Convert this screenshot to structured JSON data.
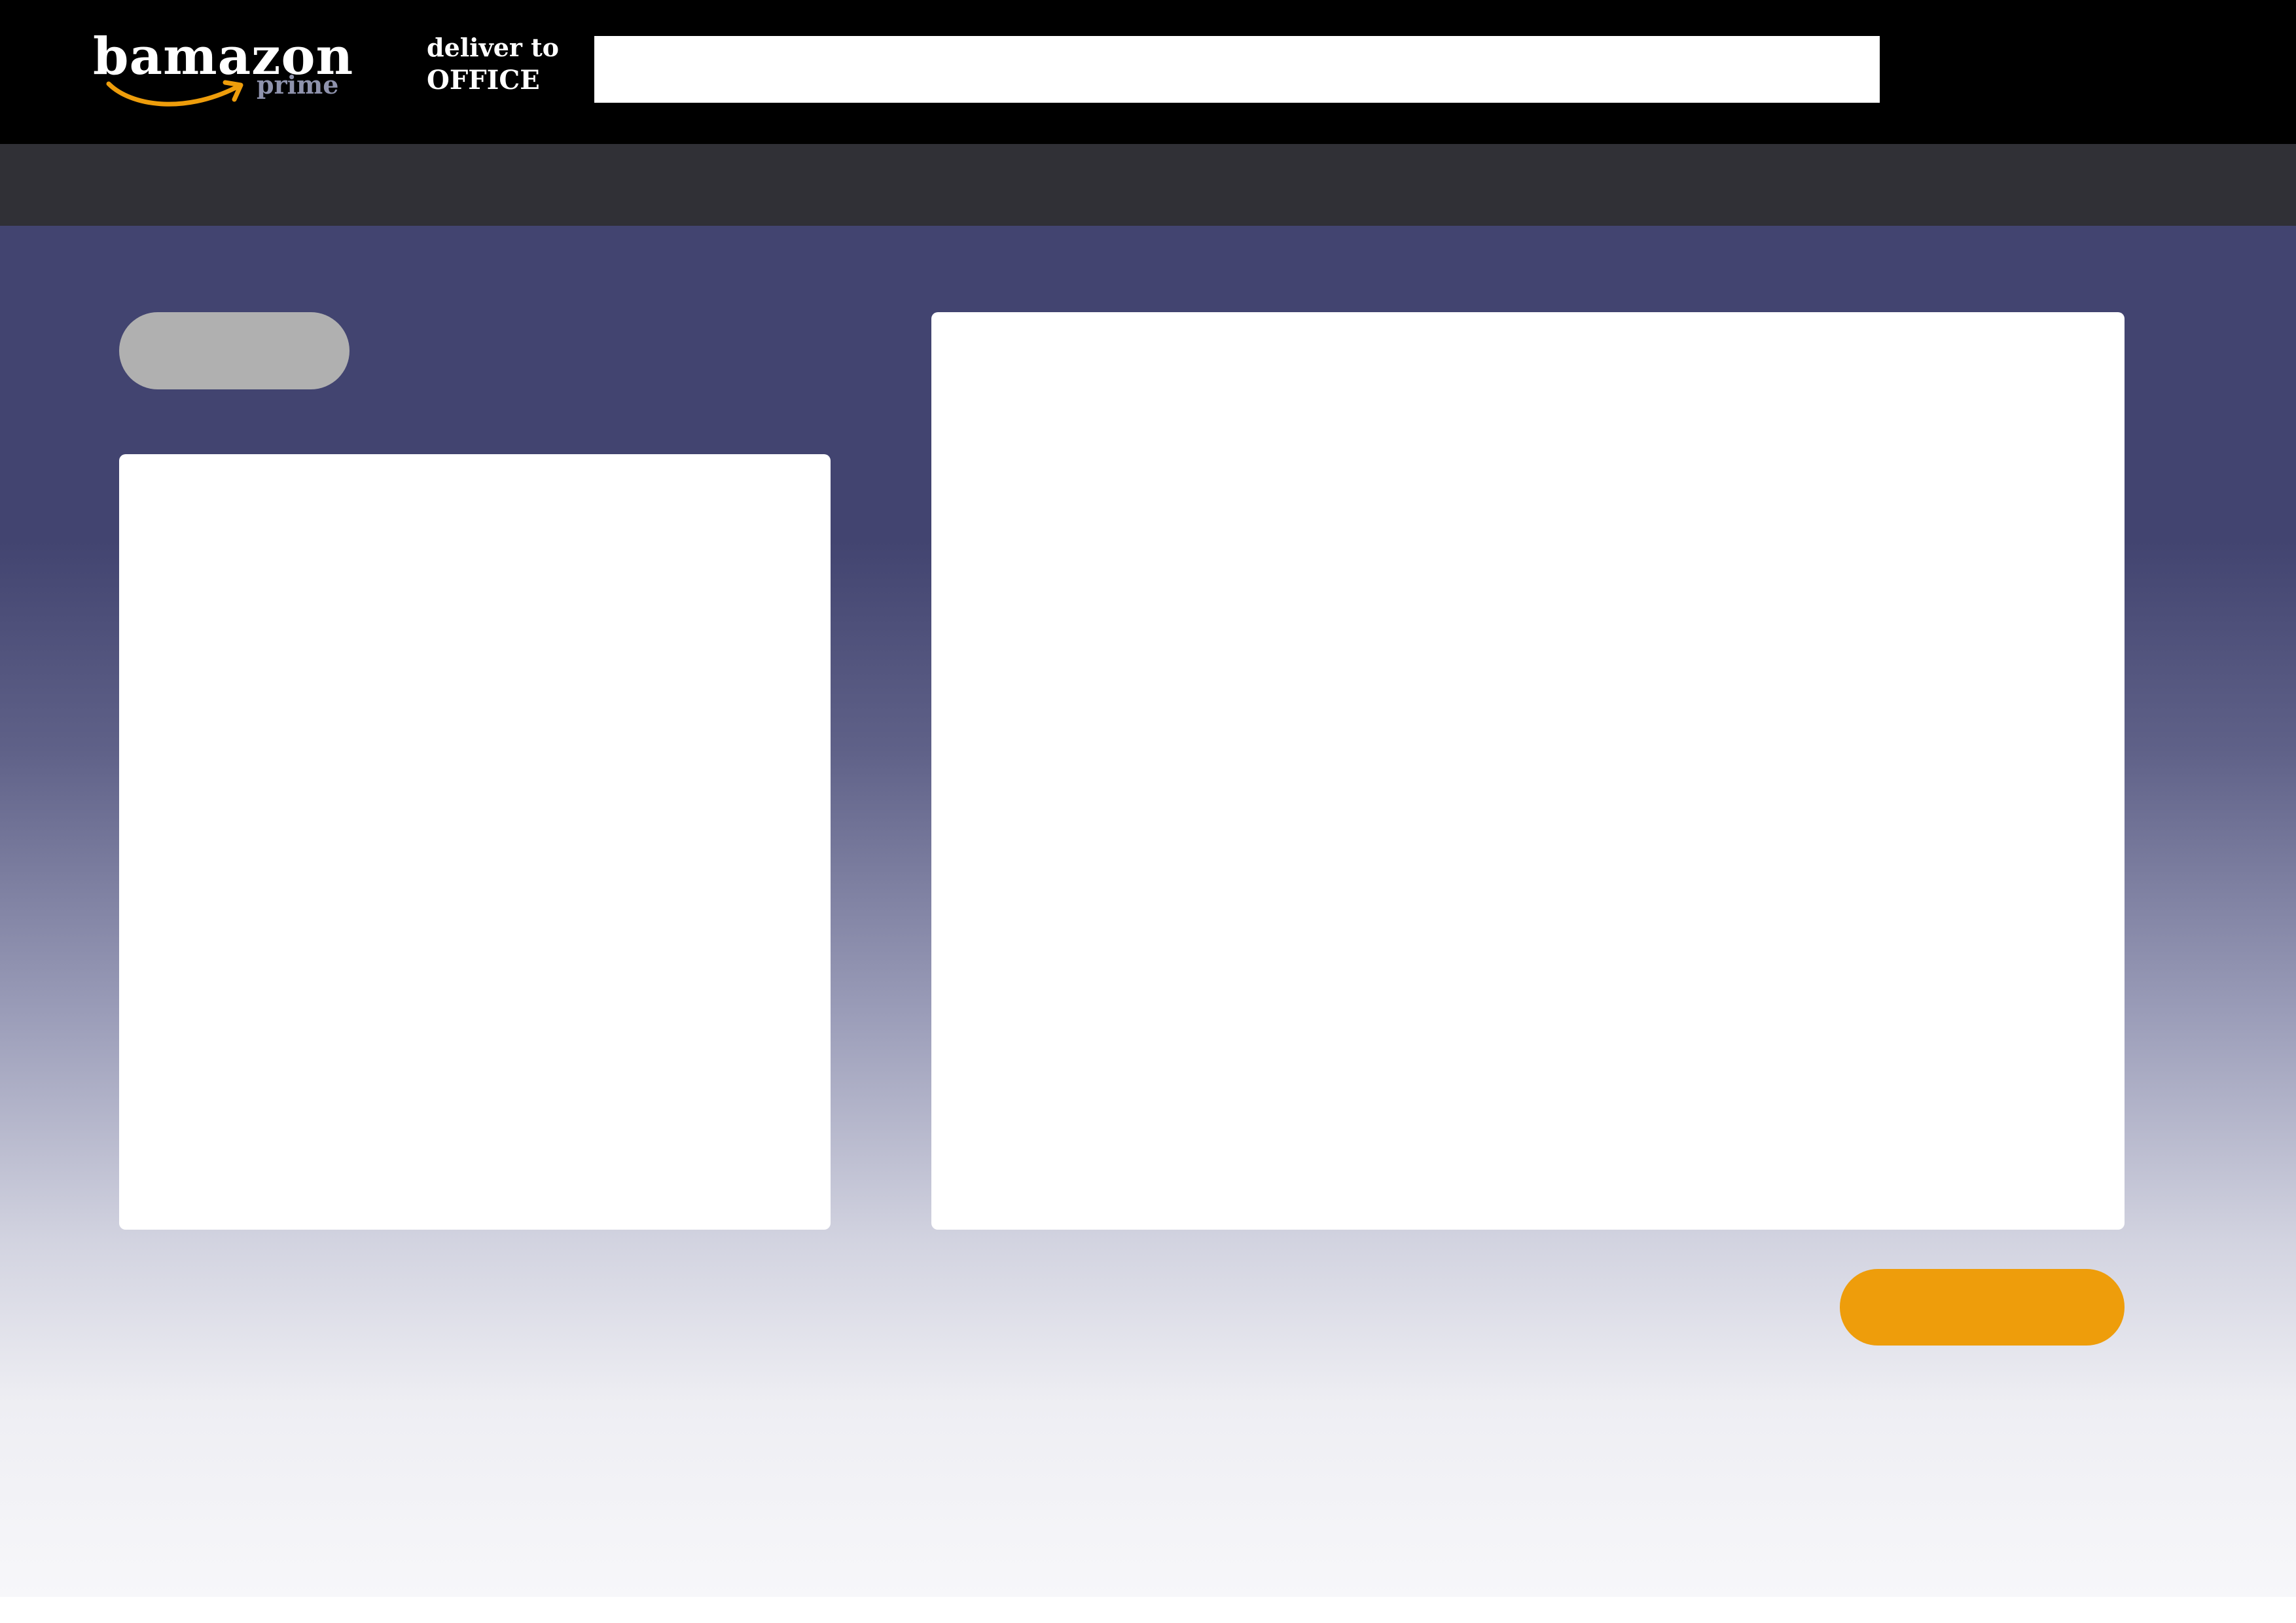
{
  "header": {
    "logo": {
      "wordmark": "bamazon",
      "tier": "prime",
      "accent_color": "#ee9d0b",
      "tier_color": "#8f93ad"
    },
    "deliver": {
      "label": "deliver to",
      "location": "OFFICE"
    },
    "search": {
      "value": ""
    },
    "background_color": "#000000"
  },
  "subnav": {
    "background_color": "#303036"
  },
  "main": {
    "background_top_color": "#424470",
    "background_bottom_color": "#f7f7fa",
    "secondary_button_color": "#b0b0b0",
    "primary_button_color": "#ee9d0b"
  },
  "icons": {
    "logo_arrow": "smile-arrow-icon"
  }
}
